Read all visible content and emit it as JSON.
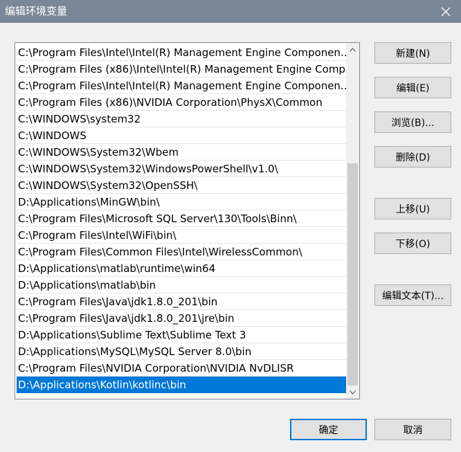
{
  "window": {
    "title": "编辑环境变量"
  },
  "icons": {
    "close": "close-icon",
    "scroll_up": "chevron-up-icon",
    "scroll_down": "chevron-down-icon"
  },
  "colors": {
    "titlebar": "#7b8796",
    "selection": "#0078d7",
    "default_button_border": "#0078d7"
  },
  "list": {
    "items": [
      "C:\\Program Files\\Intel\\Intel(R) Management Engine Componen...",
      "C:\\Program Files (x86)\\Intel\\Intel(R) Management Engine Comp...",
      "C:\\Program Files\\Intel\\Intel(R) Management Engine Componen...",
      "C:\\Program Files (x86)\\NVIDIA Corporation\\PhysX\\Common",
      "C:\\WINDOWS\\system32",
      "C:\\WINDOWS",
      "C:\\WINDOWS\\System32\\Wbem",
      "C:\\WINDOWS\\System32\\WindowsPowerShell\\v1.0\\",
      "C:\\WINDOWS\\System32\\OpenSSH\\",
      "D:\\Applications\\MinGW\\bin\\",
      "C:\\Program Files\\Microsoft SQL Server\\130\\Tools\\Binn\\",
      "C:\\Program Files\\Intel\\WiFi\\bin\\",
      "C:\\Program Files\\Common Files\\Intel\\WirelessCommon\\",
      "D:\\Applications\\matlab\\runtime\\win64",
      "D:\\Applications\\matlab\\bin",
      "C:\\Program Files\\Java\\jdk1.8.0_201\\bin",
      "C:\\Program Files\\Java\\jdk1.8.0_201\\jre\\bin",
      "D:\\Applications\\Sublime Text\\Sublime Text 3",
      "D:\\Applications\\MySQL\\MySQL Server 8.0\\bin",
      "C:\\Program Files\\NVIDIA Corporation\\NVIDIA NvDLISR",
      "D:\\Applications\\Kotlin\\kotlinc\\bin"
    ],
    "selected_index": 20
  },
  "buttons": {
    "new": "新建(N)",
    "edit": "编辑(E)",
    "browse": "浏览(B)...",
    "delete": "删除(D)",
    "move_up": "上移(U)",
    "move_down": "下移(O)",
    "edit_text": "编辑文本(T)...",
    "ok": "确定",
    "cancel": "取消"
  }
}
